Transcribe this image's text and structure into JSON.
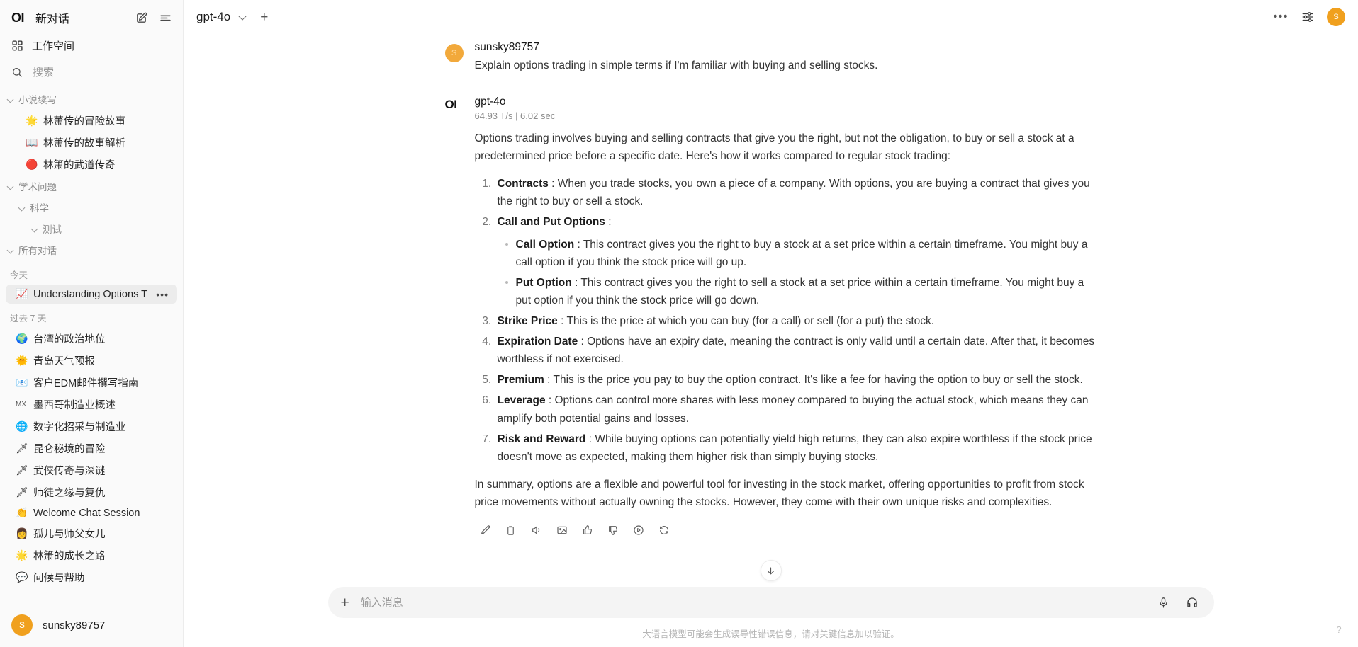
{
  "sidebar": {
    "logo": "OI",
    "title": "新对话",
    "edit_icon": "edit-square-icon",
    "collapse_icon": "collapse-sidebar-icon",
    "workspace_label": "工作空间",
    "search_placeholder": "搜索",
    "search_value": "",
    "new_chat_plus": "+",
    "folders": [
      {
        "label": "小说续写",
        "level": 0,
        "children": [
          {
            "emoji": "🌟",
            "label": "林萧传的冒险故事"
          },
          {
            "emoji": "📖",
            "label": "林萧传的故事解析"
          },
          {
            "emoji": "🔴",
            "label": "林箫的武道传奇"
          }
        ]
      },
      {
        "label": "学术问题",
        "level": 0,
        "children": []
      },
      {
        "label": "科学",
        "level": 1,
        "children": []
      },
      {
        "label": "测试",
        "level": 2,
        "children": []
      },
      {
        "label": "所有对话",
        "level": 0,
        "children": []
      }
    ],
    "groups": [
      {
        "label": "今天",
        "items": [
          {
            "emoji": "📈",
            "label": "Understanding Options T",
            "active": true,
            "menu": "•••"
          }
        ]
      },
      {
        "label": "过去 7 天",
        "items": [
          {
            "emoji": "🌍",
            "label": "台湾的政治地位",
            "active": false
          },
          {
            "emoji": "🌞",
            "label": "青岛天气预报",
            "active": false
          },
          {
            "emoji": "📧",
            "label": "客户EDM邮件撰写指南",
            "active": false
          },
          {
            "emoji": "MX",
            "label": "墨西哥制造业概述",
            "active": false
          },
          {
            "emoji": "🌐",
            "label": "数字化招采与制造业",
            "active": false
          },
          {
            "emoji": "🗡",
            "label": "昆仑秘境的冒险",
            "active": false
          },
          {
            "emoji": "🗡",
            "label": "武侠传奇与深谜",
            "active": false
          },
          {
            "emoji": "🗡",
            "label": "师徒之缘与复仇",
            "active": false
          },
          {
            "emoji": "👏",
            "label": "Welcome Chat Session",
            "active": false
          },
          {
            "emoji": "👩",
            "label": "孤儿与师父女儿",
            "active": false
          },
          {
            "emoji": "🌟",
            "label": "林箫的成长之路",
            "active": false
          },
          {
            "emoji": "💬",
            "label": "问候与帮助",
            "active": false
          }
        ]
      }
    ],
    "user": {
      "initial": "S",
      "name": "sunsky89757"
    }
  },
  "topbar": {
    "model": "gpt-4o",
    "chevron_icon": "chevron-down-icon",
    "new_tab_plus": "+",
    "more_dots": "•••",
    "controls_icon": "sliders-icon",
    "avatar_initial": "S"
  },
  "conversation": {
    "user_message": {
      "avatar_initial": "S",
      "name": "sunsky89757",
      "text": "Explain options trading in simple terms if I'm familiar with buying and selling stocks."
    },
    "bot_message": {
      "logo": "OI",
      "name": "gpt-4o",
      "meta": "64.93 T/s | 6.02 sec",
      "intro": "Options trading involves buying and selling contracts that give you the right, but not the obligation, to buy or sell a stock at a predetermined price before a specific date. Here's how it works compared to regular stock trading:",
      "items": [
        {
          "term": "Contracts",
          "sep": " : ",
          "text": "When you trade stocks, you own a piece of a company. With options, you are buying a contract that gives you the right to buy or sell a stock.",
          "sub": []
        },
        {
          "term": "Call and Put Options",
          "sep": " :",
          "text": "",
          "sub": [
            {
              "term": "Call Option",
              "sep": " : ",
              "text": "This contract gives you the right to buy a stock at a set price within a certain timeframe. You might buy a call option if you think the stock price will go up."
            },
            {
              "term": "Put Option",
              "sep": " : ",
              "text": "This contract gives you the right to sell a stock at a set price within a certain timeframe. You might buy a put option if you think the stock price will go down."
            }
          ]
        },
        {
          "term": "Strike Price",
          "sep": " : ",
          "text": "This is the price at which you can buy (for a call) or sell (for a put) the stock.",
          "sub": []
        },
        {
          "term": "Expiration Date",
          "sep": " : ",
          "text": "Options have an expiry date, meaning the contract is only valid until a certain date. After that, it becomes worthless if not exercised.",
          "sub": []
        },
        {
          "term": "Premium",
          "sep": " : ",
          "text": "This is the price you pay to buy the option contract. It's like a fee for having the option to buy or sell the stock.",
          "sub": []
        },
        {
          "term": "Leverage",
          "sep": " : ",
          "text": "Options can control more shares with less money compared to buying the actual stock, which means they can amplify both potential gains and losses.",
          "sub": []
        },
        {
          "term": "Risk and Reward",
          "sep": " : ",
          "text": "While buying options can potentially yield high returns, they can also expire worthless if the stock price doesn't move as expected, making them higher risk than simply buying stocks.",
          "sub": []
        }
      ],
      "summary": "In summary, options are a flexible and powerful tool for investing in the stock market, offering opportunities to profit from stock price movements without actually owning the stocks. However, they come with their own unique risks and complexities."
    },
    "actions": [
      "edit-icon",
      "copy-icon",
      "speaker-icon",
      "image-icon",
      "thumbs-up-icon",
      "thumbs-down-icon",
      "info-circle-icon",
      "regenerate-icon"
    ],
    "scroll_down_icon": "arrow-down-icon"
  },
  "composer": {
    "plus": "+",
    "placeholder": "输入消息",
    "value": "",
    "mic_icon": "microphone-icon",
    "headphone_icon": "headphones-icon"
  },
  "footer": {
    "disclaimer": "大语言模型可能会生成误导性错误信息，请对关键信息加以验证。",
    "help": "?"
  },
  "colors": {
    "accent": "#f0a01e",
    "sidebar_bg": "#fafafa",
    "active_item_bg": "#ececec",
    "composer_bg": "#f4f4f4"
  }
}
